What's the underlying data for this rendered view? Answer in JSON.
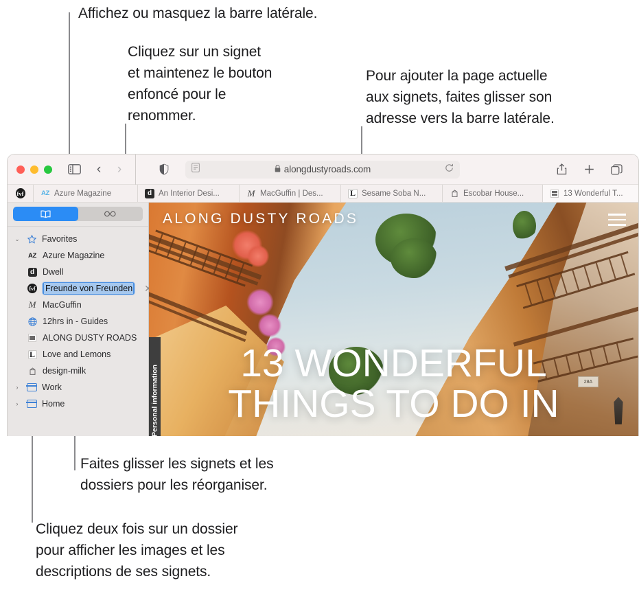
{
  "callouts": {
    "sidebar": "Affichez ou masquez la barre latérale.",
    "rename": "Cliquez sur un signet\net maintenez le bouton\nenfoncé pour le\nrenommer.",
    "add_page": "Pour ajouter la page actuelle\naux signets, faites glisser son\nadresse vers la barre latérale.",
    "drag": "Faites glisser les signets et les\ndossiers pour les réorganiser.",
    "double_click": "Cliquez deux fois sur un dossier\npour afficher les images et les\ndescriptions de ses signets."
  },
  "toolbar": {
    "sidebar_toggle": "sidebar-toggle-icon",
    "back": "‹",
    "forward": "›",
    "shield": "privacy-shield-icon",
    "reader": "reader-view-icon",
    "lock": "lock-icon",
    "url": "alongdustyroads.com",
    "reload": "⟳",
    "share": "share-icon",
    "new_tab": "+",
    "tab_overview": "tab-overview-icon"
  },
  "favorites_bar": [
    {
      "icon": "fvf-badge",
      "label": ""
    },
    {
      "icon": "az-badge",
      "label": "Azure Magazine"
    },
    {
      "icon": "d-badge",
      "label": "An Interior Desi..."
    },
    {
      "icon": "m-badge",
      "label": "MacGuffin | Des..."
    },
    {
      "icon": "l-badge",
      "label": "Sesame Soba N..."
    },
    {
      "icon": "carton-badge",
      "label": "Escobar House..."
    },
    {
      "icon": "grid-badge",
      "label": "13 Wonderful T..."
    }
  ],
  "sidebar": {
    "segments": [
      {
        "icon": "bookmarks-book-icon",
        "active": true
      },
      {
        "icon": "reading-list-glasses-icon",
        "active": false
      }
    ],
    "group": {
      "label": "Favorites",
      "icon": "star-icon",
      "expanded": true
    },
    "bookmarks": [
      {
        "label": "Azure Magazine",
        "icon": "az-badge"
      },
      {
        "label": "Dwell",
        "icon": "d-badge"
      },
      {
        "label": "Freunde von Freunden",
        "icon": "fvf-badge",
        "editing": true
      },
      {
        "label": "MacGuffin",
        "icon": "m-badge"
      },
      {
        "label": "12hrs in - Guides",
        "icon": "globe-icon"
      },
      {
        "label": "ALONG DUSTY ROADS",
        "icon": "grid-badge"
      },
      {
        "label": "Love and Lemons",
        "icon": "l-badge"
      },
      {
        "label": "design-milk",
        "icon": "carton-badge"
      }
    ],
    "folders": [
      {
        "label": "Work",
        "icon": "folder-icon",
        "expanded": false
      },
      {
        "label": "Home",
        "icon": "folder-icon",
        "expanded": false
      }
    ],
    "rename_clear": "✕"
  },
  "webpage": {
    "site_title": "ALONG DUSTY ROADS",
    "hero_title": "13 WONDERFUL\nTHINGS TO DO IN",
    "privacy_tab": "Personal information",
    "menu": "hamburger-menu-icon",
    "plaque": "28A"
  },
  "colors": {
    "accent_blue": "#2b8cf5",
    "folder_blue": "#3f82d6",
    "selection_blue": "#a6c8ee",
    "sidebar_bg": "#e9e6e5",
    "toolbar_bg": "#f7f2f2",
    "leader_line": "#8a8a8d"
  }
}
